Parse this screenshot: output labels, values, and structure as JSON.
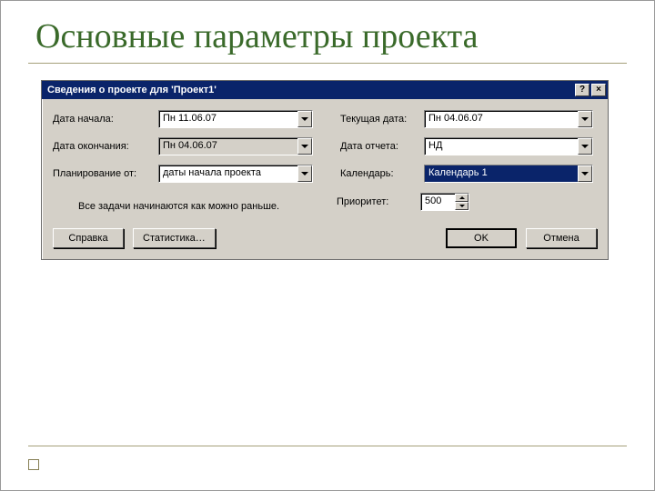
{
  "slide": {
    "title": "Основные параметры проекта"
  },
  "dialog": {
    "title": "Сведения о проекте для 'Проект1'",
    "labels": {
      "start_date": "Дата начала:",
      "end_date": "Дата окончания:",
      "plan_from": "Планирование от:",
      "current_date": "Текущая дата:",
      "report_date": "Дата отчета:",
      "calendar": "Календарь:",
      "priority": "Приоритет:"
    },
    "values": {
      "start_date": "Пн 11.06.07",
      "end_date": "Пн 04.06.07",
      "plan_from": "даты начала проекта",
      "current_date": "Пн 04.06.07",
      "report_date": "НД",
      "calendar": "Календарь 1",
      "priority": "500"
    },
    "note": "Все задачи начинаются как можно раньше.",
    "buttons": {
      "help": "Справка",
      "stats": "Статистика…",
      "ok": "OK",
      "cancel": "Отмена"
    }
  }
}
